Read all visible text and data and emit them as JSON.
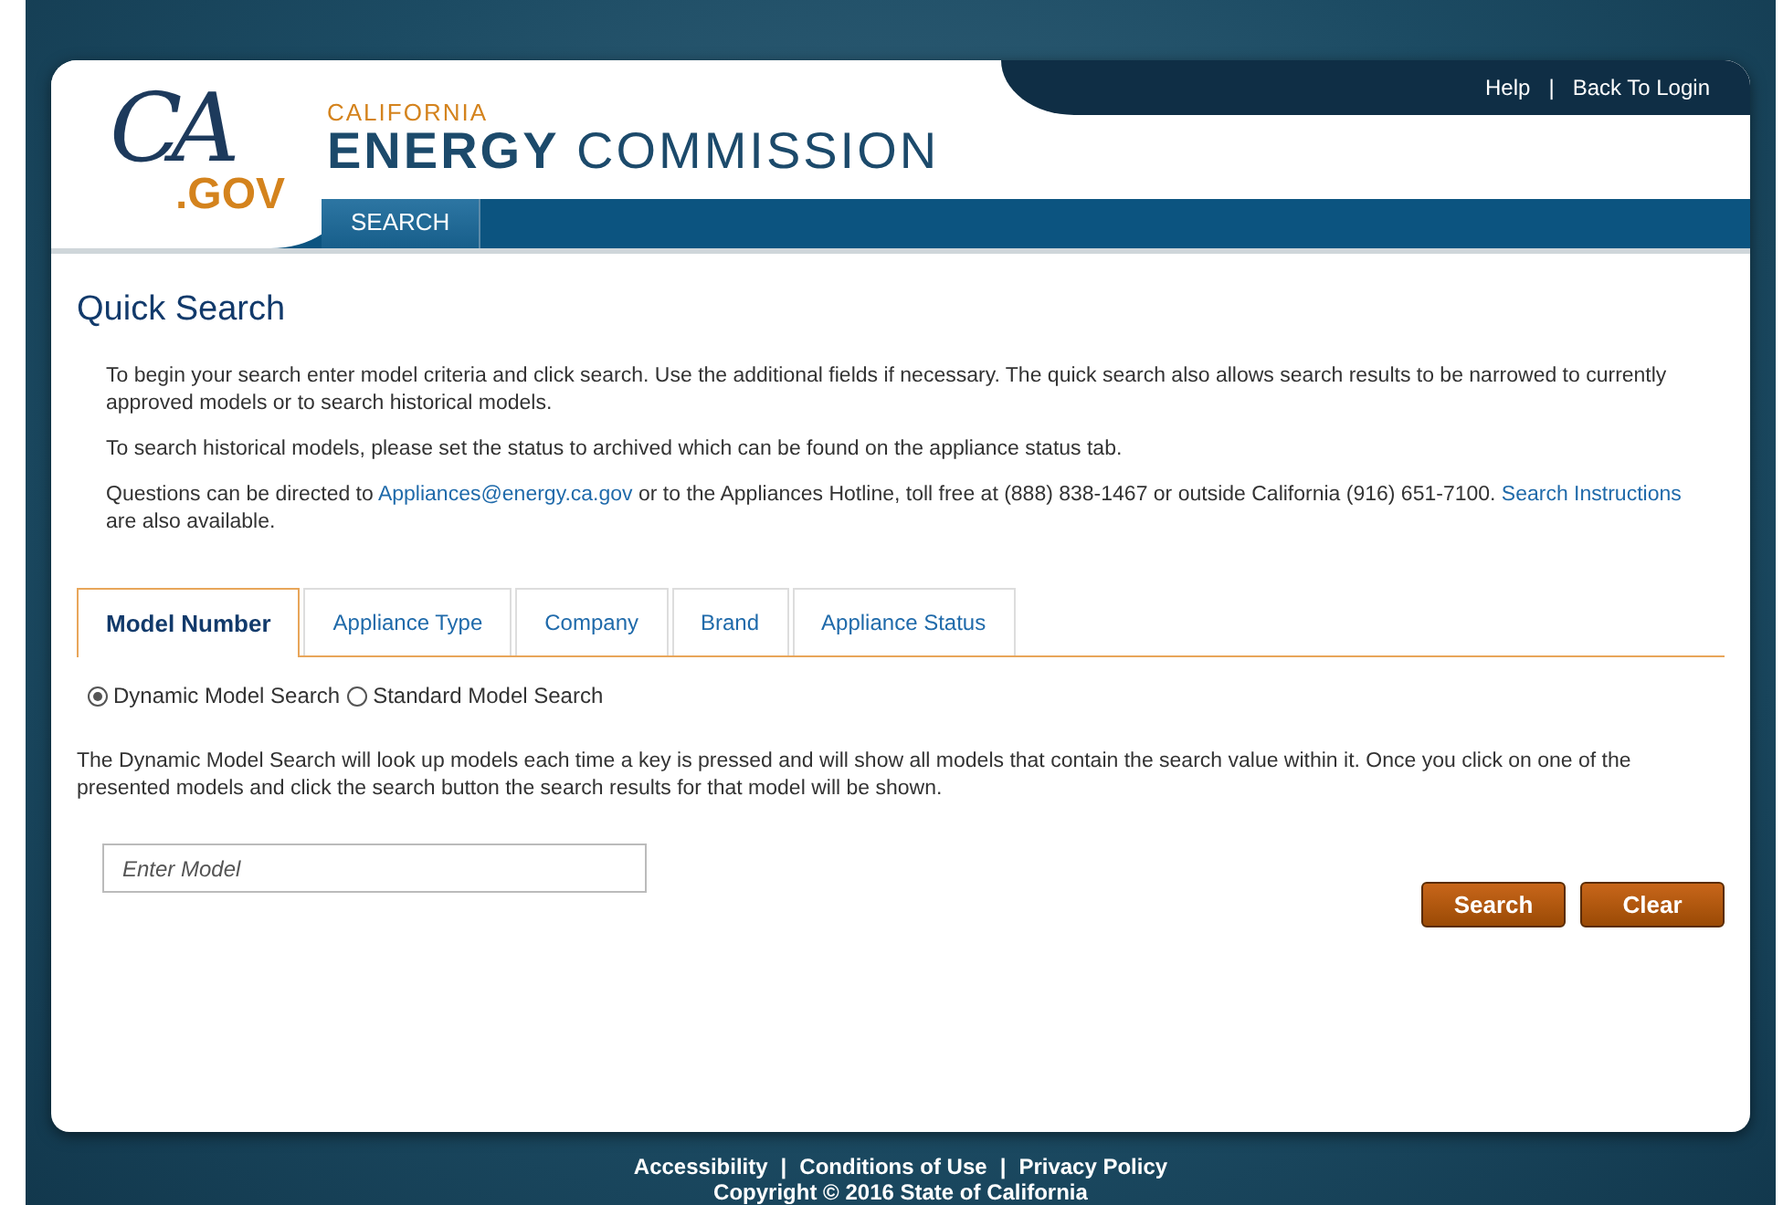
{
  "header": {
    "logo": {
      "mark": "CA",
      "suffix": ".GOV"
    },
    "agency_line1": "CALIFORNIA",
    "agency_line2_bold": "ENERGY",
    "agency_line2": "COMMISSION",
    "top_links": [
      "Help",
      "Back To Login"
    ],
    "top_link_separator": "|",
    "nav": [
      {
        "label": "SEARCH",
        "selected": true
      }
    ]
  },
  "title": "Quick Search",
  "intro": [
    [
      {
        "kind": "text",
        "text": "To begin your search enter model criteria and click search. Use the additional fields if necessary. The quick search also allows search results to be narrowed to currently approved models or to search historical models."
      }
    ],
    [
      {
        "kind": "text",
        "text": "To search historical models, please set the status to archived which can be found on the appliance status tab."
      }
    ],
    [
      {
        "kind": "text",
        "text": "Questions can be directed to "
      },
      {
        "kind": "link",
        "text": "Appliances@energy.ca.gov"
      },
      {
        "kind": "text",
        "text": " or to the Appliances Hotline, toll free at (888) 838-1467 or outside California (916) 651-7100. "
      },
      {
        "kind": "link",
        "text": "Search Instructions"
      },
      {
        "kind": "text",
        "text": " are also available."
      }
    ]
  ],
  "tabs": [
    {
      "label": "Model Number",
      "selected": true
    },
    {
      "label": "Appliance Type",
      "selected": false
    },
    {
      "label": "Company",
      "selected": false
    },
    {
      "label": "Brand",
      "selected": false
    },
    {
      "label": "Appliance Status",
      "selected": false
    }
  ],
  "search_modes": [
    {
      "label": "Dynamic Model Search",
      "selected": true
    },
    {
      "label": "Standard Model Search",
      "selected": false
    }
  ],
  "description": "The Dynamic Model Search will look up models each time a key is pressed and will show all models that contain the search value within it. Once you click on one of the presented models and click the search button the search results for that model will be shown.",
  "model_field": {
    "placeholder": "Enter Model"
  },
  "buttons": [
    "Search",
    "Clear"
  ],
  "footer": {
    "links": [
      "Accessibility",
      "Conditions of Use",
      "Privacy Policy"
    ],
    "separator": "|",
    "copyright": "Copyright © 2016 State of California"
  }
}
